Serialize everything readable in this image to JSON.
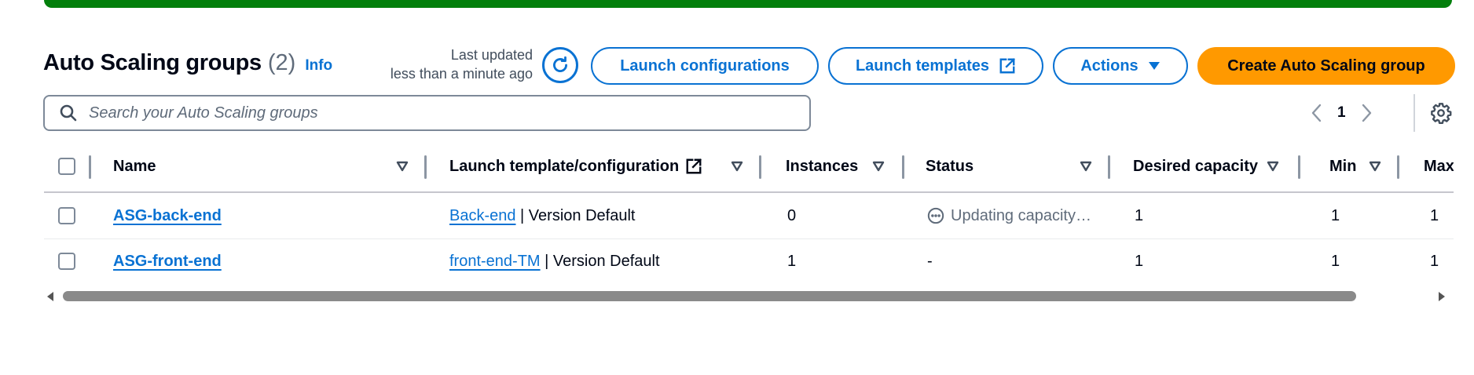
{
  "colors": {
    "accent": "#0972d3",
    "primary_button": "#ff9900",
    "success_banner": "#037f0c",
    "text": "#000716",
    "muted": "#5f6b7a"
  },
  "header": {
    "title": "Auto Scaling groups",
    "count": "(2)",
    "info": "Info",
    "last_updated_line1": "Last updated",
    "last_updated_line2": "less than a minute ago"
  },
  "toolbar": {
    "refresh_icon": "refresh-icon",
    "launch_configurations": "Launch configurations",
    "launch_templates": "Launch templates",
    "launch_templates_icon": "external-link-icon",
    "actions": "Actions",
    "actions_icon": "caret-down-icon",
    "create": "Create Auto Scaling group"
  },
  "search": {
    "placeholder": "Search your Auto Scaling groups",
    "icon": "search-icon"
  },
  "pagination": {
    "current_page": "1",
    "prev_icon": "chevron-left-icon",
    "next_icon": "chevron-right-icon",
    "settings_icon": "gear-icon"
  },
  "table": {
    "columns": [
      "Name",
      "Launch template/configuration",
      "Instances",
      "Status",
      "Desired capacity",
      "Min",
      "Max"
    ],
    "rows": [
      {
        "name": "ASG-back-end",
        "template_link": "Back-end",
        "template_suffix": " | Version Default",
        "instances": "0",
        "status": "Updating capacity…",
        "desired": "1",
        "min": "1",
        "max": "1"
      },
      {
        "name": "ASG-front-end",
        "template_link": "front-end-TM",
        "template_suffix": " | Version Default",
        "instances": "1",
        "status": "-",
        "desired": "1",
        "min": "1",
        "max": "1"
      }
    ]
  }
}
